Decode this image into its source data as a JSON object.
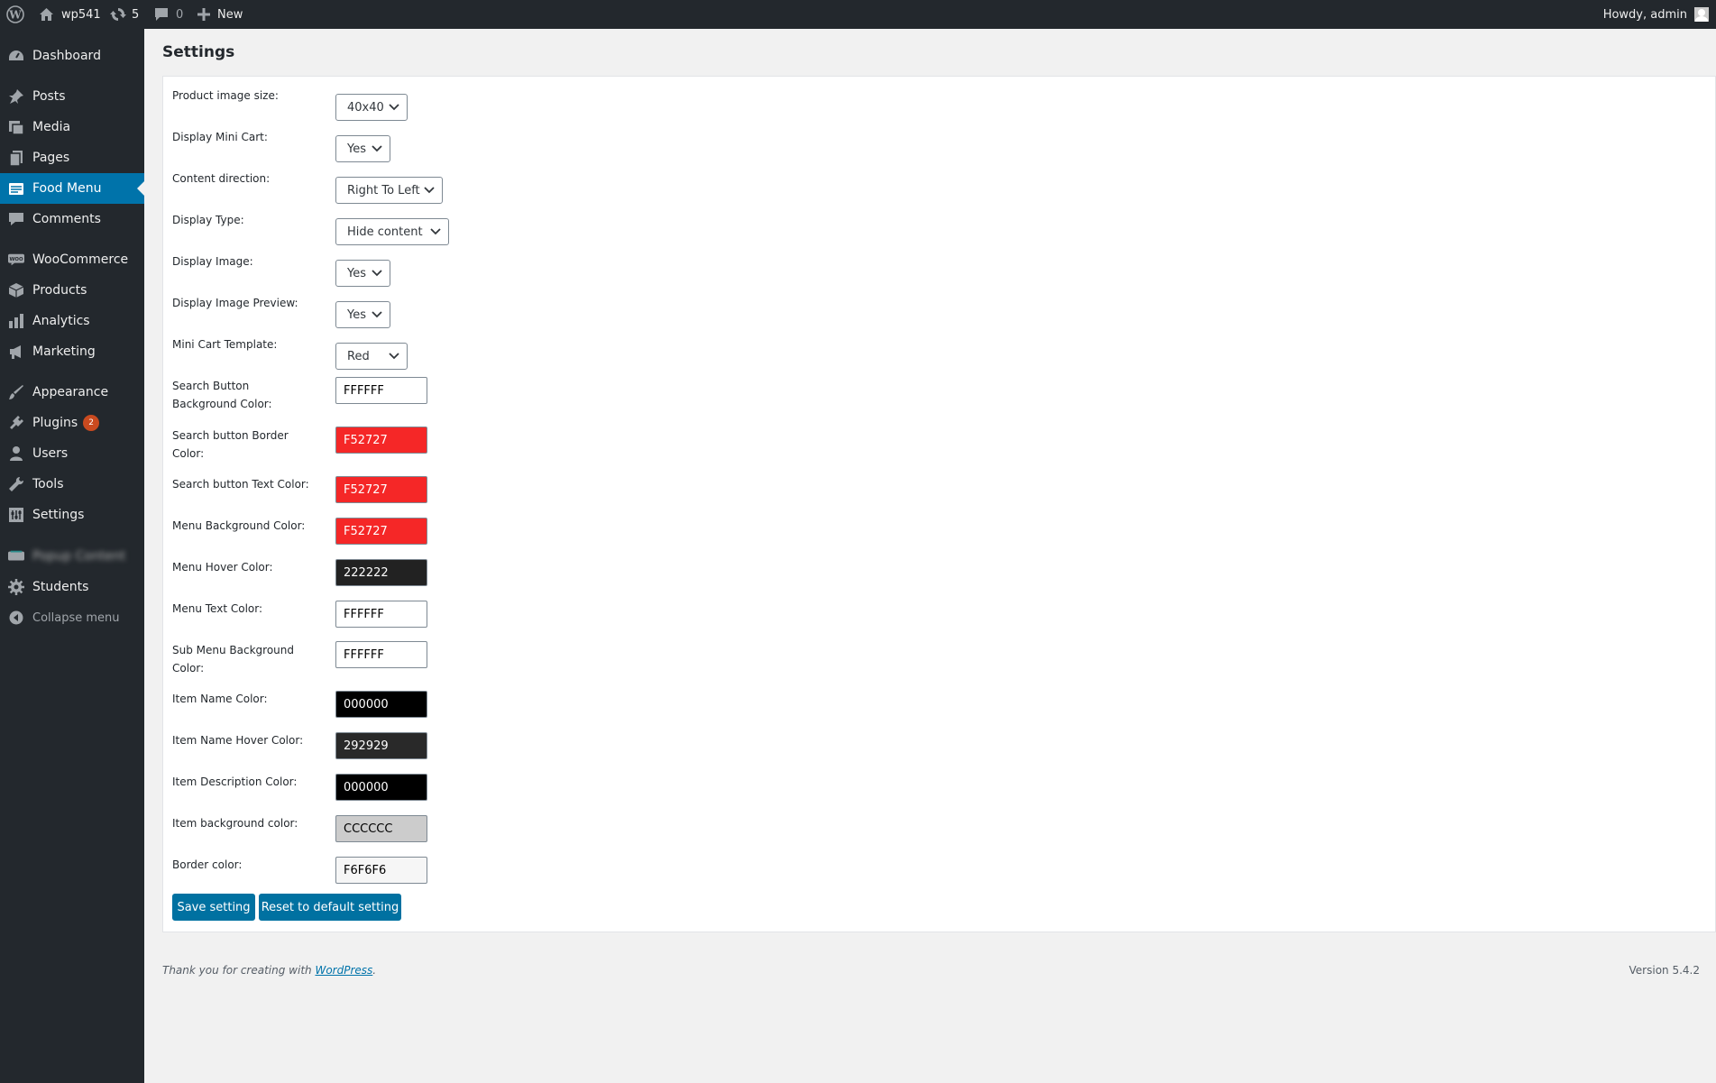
{
  "adminbar": {
    "site_name": "wp541",
    "updates_count": "5",
    "comments_count": "0",
    "new_label": "New",
    "greeting": "Howdy, admin"
  },
  "sidebar": {
    "items": [
      {
        "label": "Dashboard",
        "icon": "dashboard-icon"
      },
      {
        "label": "Posts",
        "icon": "pin-icon"
      },
      {
        "label": "Media",
        "icon": "media-icon"
      },
      {
        "label": "Pages",
        "icon": "pages-icon"
      },
      {
        "label": "Food Menu",
        "icon": "food-menu-icon",
        "active": true
      },
      {
        "label": "Comments",
        "icon": "comments-icon"
      },
      {
        "label": "WooCommerce",
        "icon": "woocommerce-icon"
      },
      {
        "label": "Products",
        "icon": "products-icon"
      },
      {
        "label": "Analytics",
        "icon": "analytics-icon"
      },
      {
        "label": "Marketing",
        "icon": "marketing-icon"
      },
      {
        "label": "Appearance",
        "icon": "appearance-icon"
      },
      {
        "label": "Plugins",
        "icon": "plugins-icon",
        "badge": "2"
      },
      {
        "label": "Users",
        "icon": "users-icon"
      },
      {
        "label": "Tools",
        "icon": "tools-icon"
      },
      {
        "label": "Settings",
        "icon": "settings-icon"
      },
      {
        "label": "Popup Content",
        "icon": "plugin-icon",
        "blurred": true
      },
      {
        "label": "Students",
        "icon": "students-gear-icon"
      },
      {
        "label": "Collapse menu",
        "icon": "collapse-icon"
      }
    ]
  },
  "page": {
    "title": "Settings"
  },
  "settings": {
    "product_image_size": {
      "label": "Product image size:",
      "value": "40x40"
    },
    "display_mini_cart": {
      "label": "Display Mini Cart:",
      "value": "Yes"
    },
    "content_direction": {
      "label": "Content direction:",
      "value": "Right To Left"
    },
    "display_type": {
      "label": "Display Type:",
      "value": "Hide content"
    },
    "display_image": {
      "label": "Display Image:",
      "value": "Yes"
    },
    "display_image_preview": {
      "label": "Display Image Preview:",
      "value": "Yes"
    },
    "mini_cart_template": {
      "label": "Mini Cart Template:",
      "value": "Red"
    },
    "search_button_bg": {
      "label": "Search Button Background Color:",
      "value": "FFFFFF",
      "bg": "#FFFFFF",
      "fg": "#000000"
    },
    "search_button_border": {
      "label": "Search button Border Color:",
      "value": "F52727",
      "bg": "#F52727",
      "fg": "#FFFFFF"
    },
    "search_button_text": {
      "label": "Search button Text Color:",
      "value": "F52727",
      "bg": "#F52727",
      "fg": "#FFFFFF"
    },
    "menu_bg": {
      "label": "Menu Background Color:",
      "value": "F52727",
      "bg": "#F52727",
      "fg": "#FFFFFF"
    },
    "menu_hover": {
      "label": "Menu Hover Color:",
      "value": "222222",
      "bg": "#222222",
      "fg": "#FFFFFF"
    },
    "menu_text": {
      "label": "Menu Text Color:",
      "value": "FFFFFF",
      "bg": "#FFFFFF",
      "fg": "#000000"
    },
    "sub_menu_bg": {
      "label": "Sub Menu Background Color:",
      "value": "FFFFFF",
      "bg": "#FFFFFF",
      "fg": "#000000"
    },
    "item_name": {
      "label": "Item Name Color:",
      "value": "000000",
      "bg": "#000000",
      "fg": "#FFFFFF"
    },
    "item_name_hover": {
      "label": "Item Name Hover Color:",
      "value": "292929",
      "bg": "#292929",
      "fg": "#FFFFFF"
    },
    "item_description": {
      "label": "Item Description Color:",
      "value": "000000",
      "bg": "#000000",
      "fg": "#FFFFFF"
    },
    "item_background": {
      "label": "Item background color:",
      "value": "CCCCCC",
      "bg": "#CCCCCC",
      "fg": "#000000"
    },
    "border_color": {
      "label": "Border color:",
      "value": "F6F6F6",
      "bg": "#F6F6F6",
      "fg": "#000000"
    }
  },
  "buttons": {
    "save": "Save setting",
    "reset": "Reset to default setting"
  },
  "footer": {
    "thanks_prefix": "Thank you for creating with ",
    "thanks_link": "WordPress",
    "thanks_suffix": ".",
    "version": "Version 5.4.2"
  },
  "colors": {
    "sidebar_bg": "#23282d",
    "accent": "#0073aa",
    "button": "#0071a1",
    "badge": "#ca4a1f"
  }
}
